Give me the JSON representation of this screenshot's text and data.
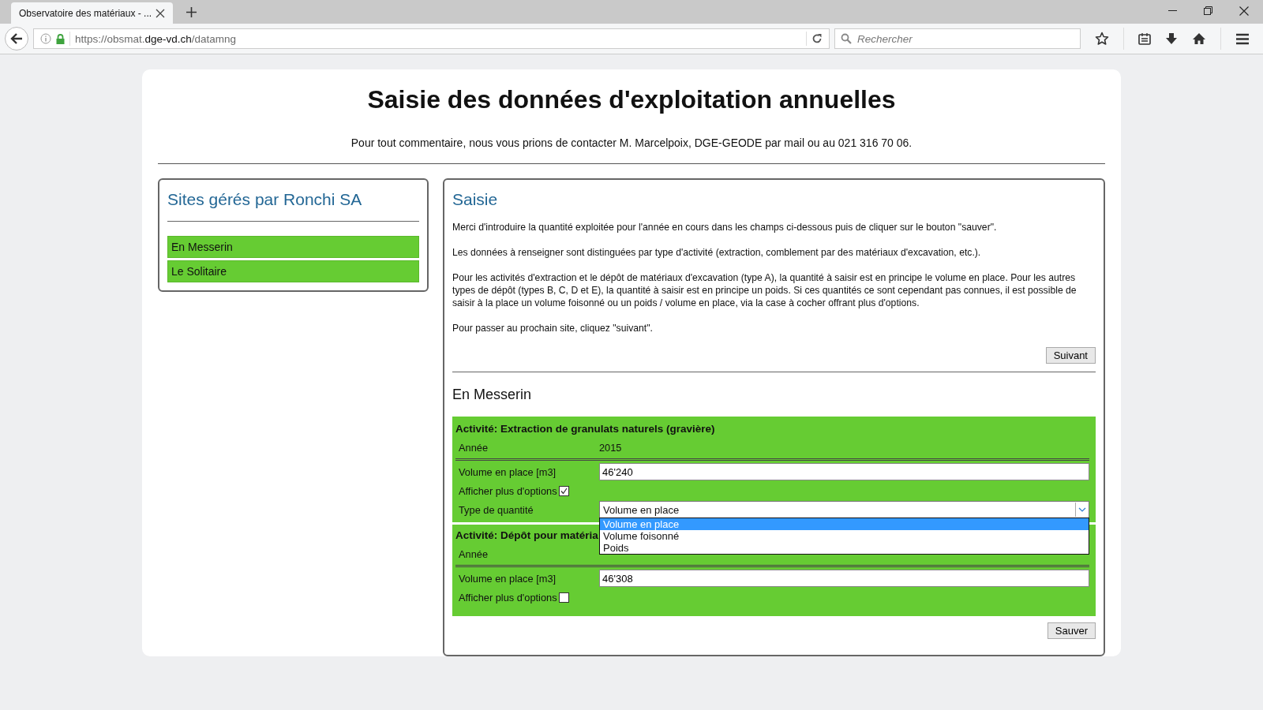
{
  "browser": {
    "tab": {
      "title": "Observatoire des matériaux - ...",
      "selected": true
    },
    "url": {
      "prefix": "https://obsmat.",
      "domain": "dge-vd.ch",
      "path": "/datamng"
    },
    "search": {
      "placeholder": "Rechercher"
    }
  },
  "page": {
    "title": "Saisie des données d'exploitation annuelles",
    "contact": "Pour tout commentaire, nous vous prions de contacter M. Marcelpoix, DGE-GEODE par mail ou au 021 316 70 06."
  },
  "sites": {
    "heading": "Sites gérés par Ronchi SA",
    "items": [
      {
        "label": "En Messerin"
      },
      {
        "label": "Le Solitaire"
      }
    ]
  },
  "saisie": {
    "heading": "Saisie",
    "paragraphs": [
      "Merci d'introduire la quantité exploitée pour l'année en cours dans les champs ci-dessous puis de cliquer sur le bouton \"sauver\".",
      "Les données à renseigner sont distinguées par type d'activité (extraction, comblement par des matériaux d'excavation, etc.).",
      "Pour les activités d'extraction et le dépôt de matériaux d'excavation (type A), la quantité à saisir est en principe le volume en place. Pour les autres types de dépôt (types B, C, D et E), la quantité à saisir est en principe un poids. Si ces quantités ce sont cependant pas connues, il est possible de saisir à la place un volume foisonné ou un poids / volume en place, via la case à cocher offrant plus d'options.",
      "Pour passer au prochain site, cliquez \"suivant\"."
    ],
    "next_button": "Suivant",
    "site_name": "En Messerin",
    "activities": [
      {
        "title": "Activité: Extraction de granulats naturels (gravière)",
        "rows": [
          {
            "kind": "static",
            "label": "Année",
            "value": "2015"
          },
          {
            "kind": "input",
            "label": "Volume en place [m3]",
            "value": "46'240"
          },
          {
            "kind": "checkbox",
            "label": "Afficher plus d'options",
            "checked": true
          },
          {
            "kind": "select",
            "label": "Type de quantité",
            "value": "Volume en place",
            "expanded": true,
            "options": [
              {
                "label": "Volume en place",
                "selected": true
              },
              {
                "label": "Volume foisonné",
                "selected": false
              },
              {
                "label": "Poids",
                "selected": false
              }
            ]
          }
        ]
      },
      {
        "title": "Activité: Dépôt pour matéria",
        "rows": [
          {
            "kind": "static",
            "label": "Année"
          },
          {
            "kind": "input",
            "label": "Volume en place [m3]",
            "value": "46'308"
          },
          {
            "kind": "checkbox",
            "label": "Afficher plus d'options",
            "checked": false
          }
        ]
      }
    ],
    "save_button": "Sauver"
  }
}
